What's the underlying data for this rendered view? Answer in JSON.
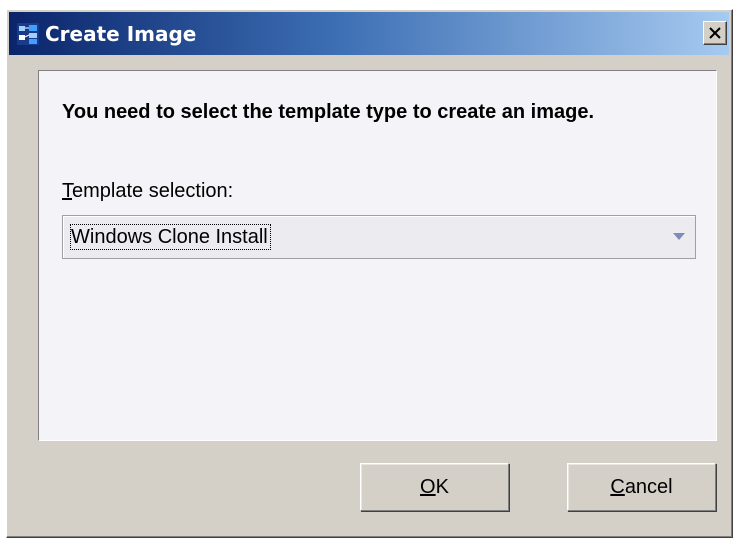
{
  "window": {
    "title": "Create Image",
    "app_icon": "network-app-icon",
    "close_icon": "close-icon"
  },
  "content": {
    "heading": "You need to select the template type to create an image.",
    "field_label_mnemonic": "T",
    "field_label_rest": "emplate selection:",
    "select": {
      "value": "Windows Clone Install",
      "arrow_icon": "chevron-down-icon"
    }
  },
  "buttons": {
    "ok_mnemonic": "O",
    "ok_rest": "K",
    "cancel_mnemonic": "C",
    "cancel_rest": "ancel"
  },
  "colors": {
    "titlebar_start": "#0a246a",
    "titlebar_end": "#a6caf0",
    "dialog_face": "#d4d0c8",
    "panel_bg": "#f4f4f8"
  }
}
